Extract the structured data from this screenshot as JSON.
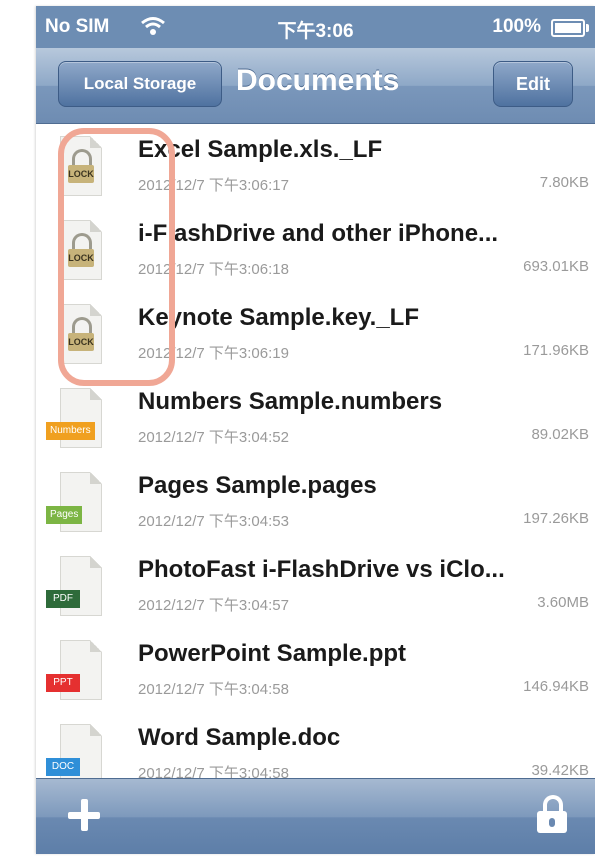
{
  "status_bar": {
    "carrier": "No SIM",
    "wifi_icon": "wifi-icon",
    "time": "下午3:06",
    "battery": "100%",
    "battery_icon": "battery-icon"
  },
  "nav": {
    "back_label": "Local Storage",
    "title": "Documents",
    "edit_label": "Edit"
  },
  "files": [
    {
      "name": "Excel Sample.xls._LF",
      "date": "2012/12/7 下午3:06:17",
      "size": "7.80KB",
      "icon": "locked-file-icon",
      "locked": true
    },
    {
      "name": "i-FlashDrive and other iPhone...",
      "date": "2012/12/7 下午3:06:18",
      "size": "693.01KB",
      "icon": "locked-file-icon",
      "locked": true
    },
    {
      "name": "Keynote Sample.key._LF",
      "date": "2012/12/7 下午3:06:19",
      "size": "171.96KB",
      "icon": "locked-file-icon",
      "locked": true
    },
    {
      "name": "Numbers Sample.numbers",
      "date": "2012/12/7 下午3:04:52",
      "size": "89.02KB",
      "icon": "numbers-file-icon",
      "tag": "Numbers",
      "tag_color": "#f0a020"
    },
    {
      "name": "Pages Sample.pages",
      "date": "2012/12/7 下午3:04:53",
      "size": "197.26KB",
      "icon": "pages-file-icon",
      "tag": "Pages",
      "tag_color": "#7cb544"
    },
    {
      "name": "PhotoFast i-FlashDrive vs iClo...",
      "date": "2012/12/7 下午3:04:57",
      "size": "3.60MB",
      "icon": "pdf-file-icon",
      "tag": "PDF",
      "tag_color": "#2e6b3a"
    },
    {
      "name": "PowerPoint Sample.ppt",
      "date": "2012/12/7 下午3:04:58",
      "size": "146.94KB",
      "icon": "ppt-file-icon",
      "tag": "PPT",
      "tag_color": "#e53030"
    },
    {
      "name": "Word Sample.doc",
      "date": "2012/12/7 下午3:04:58",
      "size": "39.42KB",
      "icon": "doc-file-icon",
      "tag": "DOC",
      "tag_color": "#2f8fd8"
    }
  ],
  "toolbar": {
    "add_icon": "plus-icon",
    "lock_icon": "lock-icon"
  },
  "colors": {
    "nav_bar": "#7a97bb",
    "highlight": "#f0a795"
  }
}
